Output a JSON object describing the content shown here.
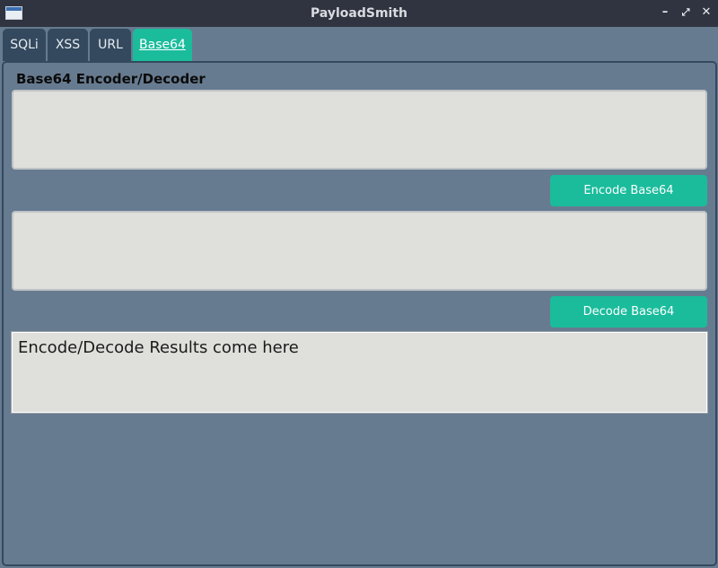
{
  "window": {
    "title": "PayloadSmith",
    "controls": {
      "minimize": "–",
      "maximize": "⤢",
      "close": "✕"
    }
  },
  "tabs": [
    {
      "label": "SQLi",
      "active": false
    },
    {
      "label": "XSS",
      "active": false
    },
    {
      "label": "URL",
      "active": false
    },
    {
      "label": "Base64",
      "active": true
    }
  ],
  "main": {
    "heading": "Base64 Encoder/Decoder",
    "encode_input": {
      "value": ""
    },
    "encode_button": "Encode Base64",
    "decode_input": {
      "value": ""
    },
    "decode_button": "Decode Base64",
    "result_text": "Encode/Decode Results come here"
  },
  "colors": {
    "accent": "#1abc9c",
    "tab_inactive": "#34495e",
    "background": "#677b90",
    "titlebar": "#2f3440"
  }
}
